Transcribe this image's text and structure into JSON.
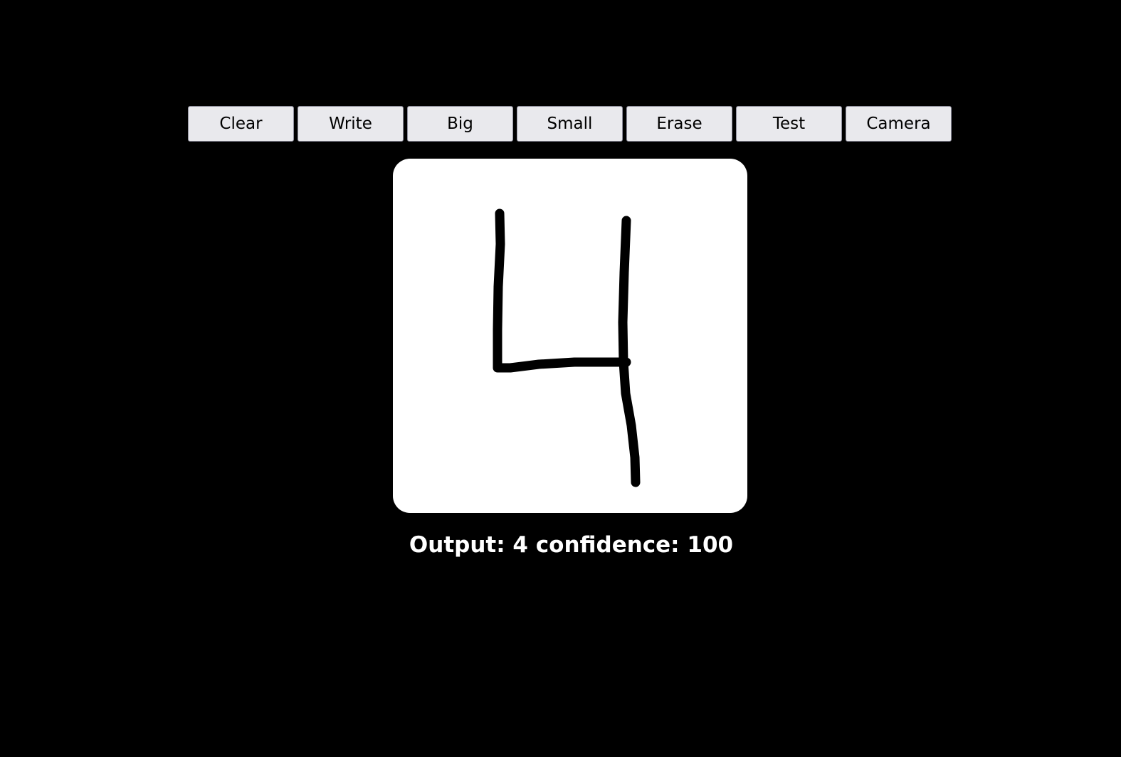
{
  "toolbar": {
    "buttons": [
      {
        "label": "Clear"
      },
      {
        "label": "Write"
      },
      {
        "label": "Big"
      },
      {
        "label": "Small"
      },
      {
        "label": "Erase"
      },
      {
        "label": "Test"
      },
      {
        "label": "Camera"
      }
    ]
  },
  "output": {
    "text": "Output: 4 confidence: 100",
    "digit": "4",
    "confidence": "100"
  },
  "colors": {
    "background": "#000000",
    "canvas": "#ffffff",
    "stroke": "#000000",
    "button_bg": "#e9e9ed",
    "output_text": "#ffffff"
  }
}
